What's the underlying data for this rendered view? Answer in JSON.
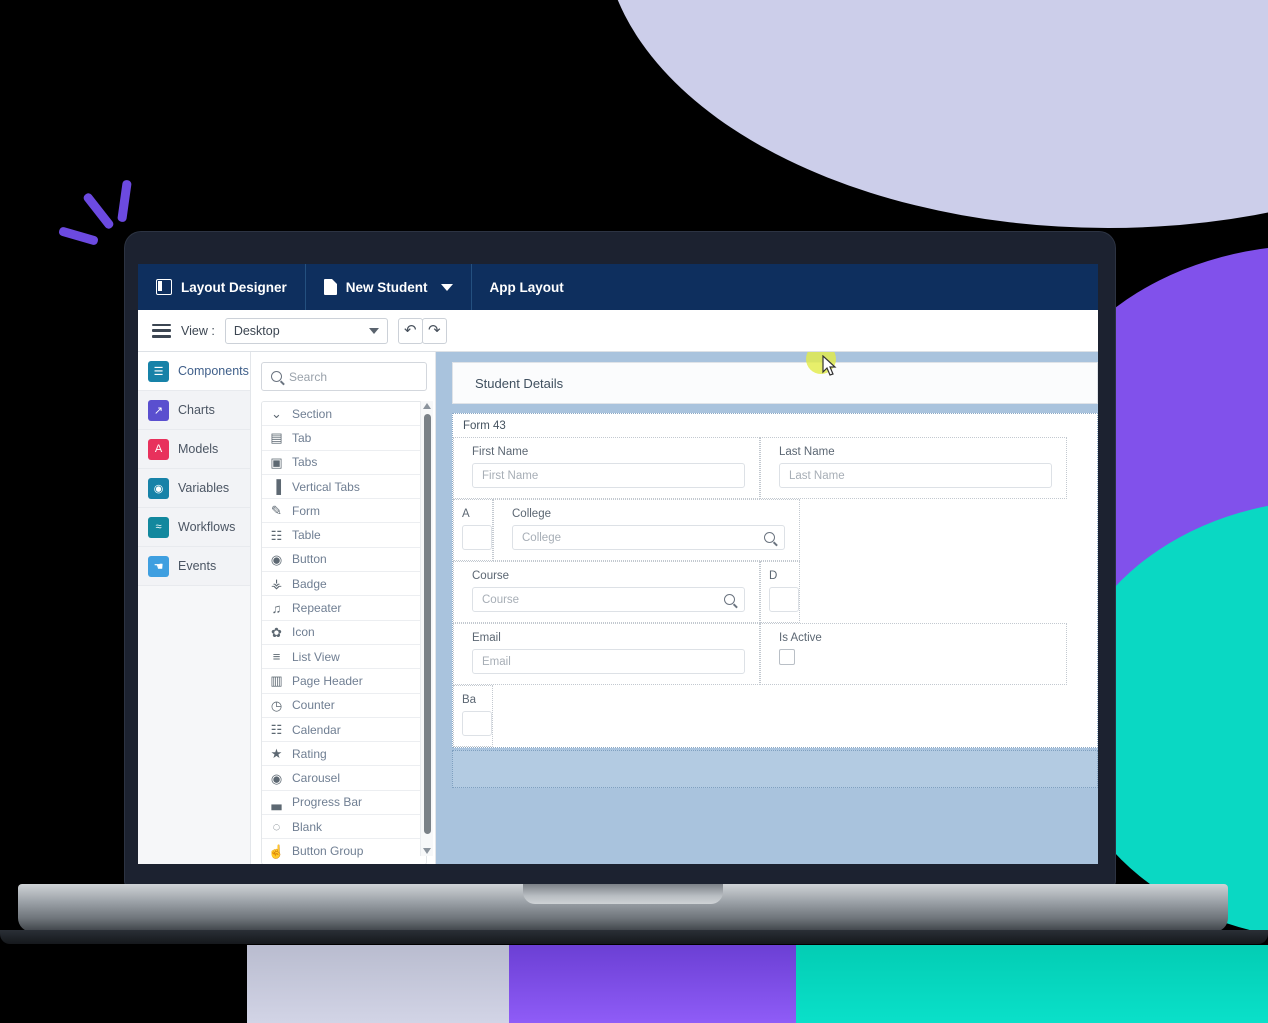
{
  "app_header": {
    "title": "Layout Designer",
    "title_icon": "layout-grid-icon",
    "document_name": "New Student",
    "document_icon": "document-icon",
    "document_caret_icon": "chevron-down-icon",
    "tab_label": "App Layout"
  },
  "toolbar": {
    "menu_icon": "hamburger-menu-icon",
    "view_label": "View :",
    "view_value": "Desktop",
    "view_caret_icon": "caret-down-icon",
    "undo_icon": "undo-arrow-icon",
    "undo_glyph": "↶",
    "redo_icon": "redo-arrow-icon",
    "redo_glyph": "↷"
  },
  "nav_rail": {
    "items": [
      {
        "label": "Components",
        "icon": "components-list-icon",
        "glyph": "☰",
        "color": "#1782a8",
        "active": true
      },
      {
        "label": "Charts",
        "icon": "charts-line-icon",
        "glyph": "↗",
        "color": "#5a4fcf",
        "active": false
      },
      {
        "label": "Models",
        "icon": "models-icon",
        "glyph": "A",
        "color": "#e8315c",
        "active": false
      },
      {
        "label": "Variables",
        "icon": "variables-globe-icon",
        "glyph": "◉",
        "color": "#1782a8",
        "active": false
      },
      {
        "label": "Workflows",
        "icon": "workflows-icon",
        "glyph": "≈",
        "color": "#12889e",
        "active": false
      },
      {
        "label": "Events",
        "icon": "events-click-icon",
        "glyph": "☚",
        "color": "#3f9fe0",
        "active": false
      }
    ]
  },
  "components_panel": {
    "search_placeholder": "Search",
    "search_icon": "search-icon",
    "items": [
      {
        "label": "Section",
        "icon": "chevron-down-icon",
        "glyph": "⌄"
      },
      {
        "label": "Tab",
        "icon": "tab-icon",
        "glyph": "▤"
      },
      {
        "label": "Tabs",
        "icon": "tabs-icon",
        "glyph": "▣"
      },
      {
        "label": "Vertical Tabs",
        "icon": "vertical-tabs-icon",
        "glyph": "▐"
      },
      {
        "label": "Form",
        "icon": "form-icon",
        "glyph": "✎"
      },
      {
        "label": "Table",
        "icon": "table-grid-icon",
        "glyph": "☷"
      },
      {
        "label": "Button",
        "icon": "button-circle-icon",
        "glyph": "◉"
      },
      {
        "label": "Badge",
        "icon": "badge-icon",
        "glyph": "⚶"
      },
      {
        "label": "Repeater",
        "icon": "repeater-icon",
        "glyph": "♫"
      },
      {
        "label": "Icon",
        "icon": "palette-icon",
        "glyph": "✿"
      },
      {
        "label": "List View",
        "icon": "list-view-icon",
        "glyph": "≡"
      },
      {
        "label": "Page Header",
        "icon": "page-header-icon",
        "glyph": "▥"
      },
      {
        "label": "Counter",
        "icon": "clock-icon",
        "glyph": "◷"
      },
      {
        "label": "Calendar",
        "icon": "calendar-icon",
        "glyph": "☷"
      },
      {
        "label": "Rating",
        "icon": "star-icon",
        "glyph": "★"
      },
      {
        "label": "Carousel",
        "icon": "carousel-icon",
        "glyph": "◉"
      },
      {
        "label": "Progress Bar",
        "icon": "progress-bar-icon",
        "glyph": "▃"
      },
      {
        "label": "Blank",
        "icon": "blank-dashed-icon",
        "glyph": "◌"
      },
      {
        "label": "Button Group",
        "icon": "button-group-icon",
        "glyph": "☝"
      }
    ],
    "scrollbar": {
      "up_icon": "scroll-up-arrow-icon",
      "down_icon": "scroll-down-arrow-icon"
    }
  },
  "canvas": {
    "section_title": "Student Details",
    "form_title": "Form 43",
    "fields": [
      {
        "label": "First Name",
        "placeholder": "First Name",
        "type": "text"
      },
      {
        "label": "Last Name",
        "placeholder": "Last Name",
        "type": "text"
      },
      {
        "label": "A",
        "placeholder": "",
        "type": "truncated"
      },
      {
        "label": "College",
        "placeholder": "College",
        "type": "lookup",
        "icon": "search-icon"
      },
      {
        "label": "Course",
        "placeholder": "Course",
        "type": "lookup",
        "icon": "search-icon"
      },
      {
        "label": "D",
        "placeholder": "",
        "type": "truncated"
      },
      {
        "label": "Email",
        "placeholder": "Email",
        "type": "text"
      },
      {
        "label": "Is Active",
        "placeholder": "",
        "type": "checkbox"
      },
      {
        "label": "Ba",
        "placeholder": "",
        "type": "truncated"
      }
    ],
    "cursor": {
      "icon": "mouse-cursor-icon",
      "highlight_color": "#e2ec4a"
    }
  },
  "decor": {
    "lavender": "#ccceea",
    "purple": "#8151eb",
    "teal": "#0ad8c3",
    "burst_color": "#6c4ae0",
    "burst_icon": "click-burst-icon"
  }
}
